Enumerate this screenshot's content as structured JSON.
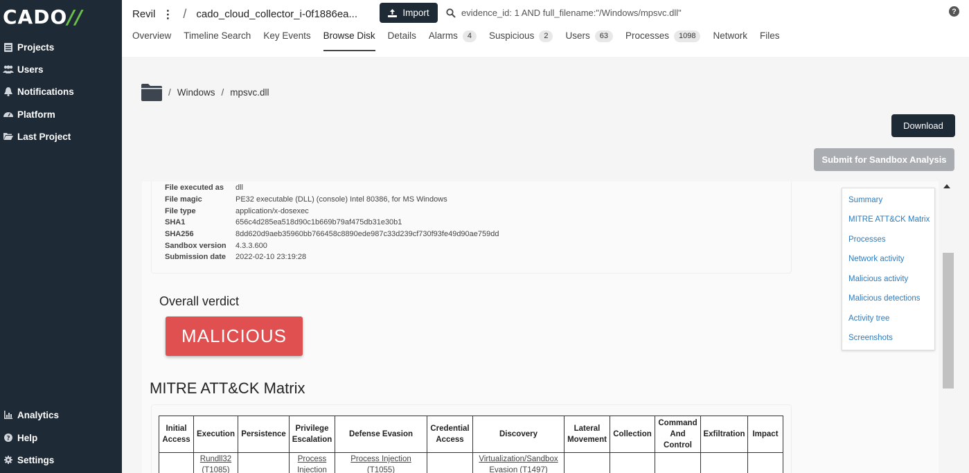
{
  "sidebar": {
    "logo_text": "CADO",
    "logo_slashes": "//",
    "items": [
      {
        "label": "Projects",
        "icon": "list-icon"
      },
      {
        "label": "Users",
        "icon": "users-icon"
      },
      {
        "label": "Notifications",
        "icon": "bell-icon"
      },
      {
        "label": "Platform",
        "icon": "gauge-icon"
      },
      {
        "label": "Last Project",
        "icon": "folder-open-icon"
      }
    ],
    "bottom_items": [
      {
        "label": "Analytics",
        "icon": "chart-icon"
      },
      {
        "label": "Help",
        "icon": "help-icon"
      },
      {
        "label": "Settings",
        "icon": "gear-icon"
      }
    ]
  },
  "header": {
    "project": "Revil",
    "evidence": "cado_cloud_collector_i-0f1886ea...",
    "import_label": "Import",
    "search_value": "evidence_id: 1 AND full_filename:\"/Windows/mpsvc.dll\"",
    "help": "?"
  },
  "tabs": [
    {
      "label": "Overview"
    },
    {
      "label": "Timeline Search"
    },
    {
      "label": "Key Events"
    },
    {
      "label": "Browse Disk",
      "active": true
    },
    {
      "label": "Details"
    },
    {
      "label": "Alarms",
      "count": "4"
    },
    {
      "label": "Suspicious",
      "count": "2"
    },
    {
      "label": "Users",
      "count": "63"
    },
    {
      "label": "Processes",
      "count": "1098"
    },
    {
      "label": "Network"
    },
    {
      "label": "Files"
    }
  ],
  "path": {
    "sep": "/",
    "parts": [
      "Windows",
      "mpsvc.dll"
    ]
  },
  "buttons": {
    "download": "Download",
    "sandbox": "Submit for Sandbox Analysis"
  },
  "file_info": [
    {
      "key": "File executed as",
      "value": "dll"
    },
    {
      "key": "File magic",
      "value": "PE32 executable (DLL) (console) Intel 80386, for MS Windows"
    },
    {
      "key": "File type",
      "value": "application/x-dosexec"
    },
    {
      "key": "SHA1",
      "value": "656c4d285ea518d90c1b669b79af475db31e30b1"
    },
    {
      "key": "SHA256",
      "value": "8dd620d9aeb35960bb766458c8890ede987c33d239cf730f93fe49d90ae759dd"
    },
    {
      "key": "Sandbox version",
      "value": "4.3.3.600"
    },
    {
      "key": "Submission date",
      "value": "2022-02-10 23:19:28"
    }
  ],
  "verdict": {
    "label": "Overall verdict",
    "value": "MALICIOUS",
    "color": "#e05050"
  },
  "mitre": {
    "title": "MITRE ATT&CK Matrix",
    "columns": [
      "Initial Access",
      "Execution",
      "Persistence",
      "Privilege Escalation",
      "Defense Evasion",
      "Credential Access",
      "Discovery",
      "Lateral Movement",
      "Collection",
      "Command And Control",
      "Exfiltration",
      "Impact"
    ],
    "row": [
      "",
      "Rundll32 (T1085)",
      "",
      "Process Injection",
      "Process Injection (T1055)",
      "",
      "Virtualization/Sandbox Evasion (T1497)",
      "",
      "",
      "",
      "",
      ""
    ]
  },
  "toc": [
    "Summary",
    "MITRE ATT&CK Matrix",
    "Processes",
    "Network activity",
    "Malicious activity",
    "Malicious detections",
    "Activity tree",
    "Screenshots"
  ]
}
